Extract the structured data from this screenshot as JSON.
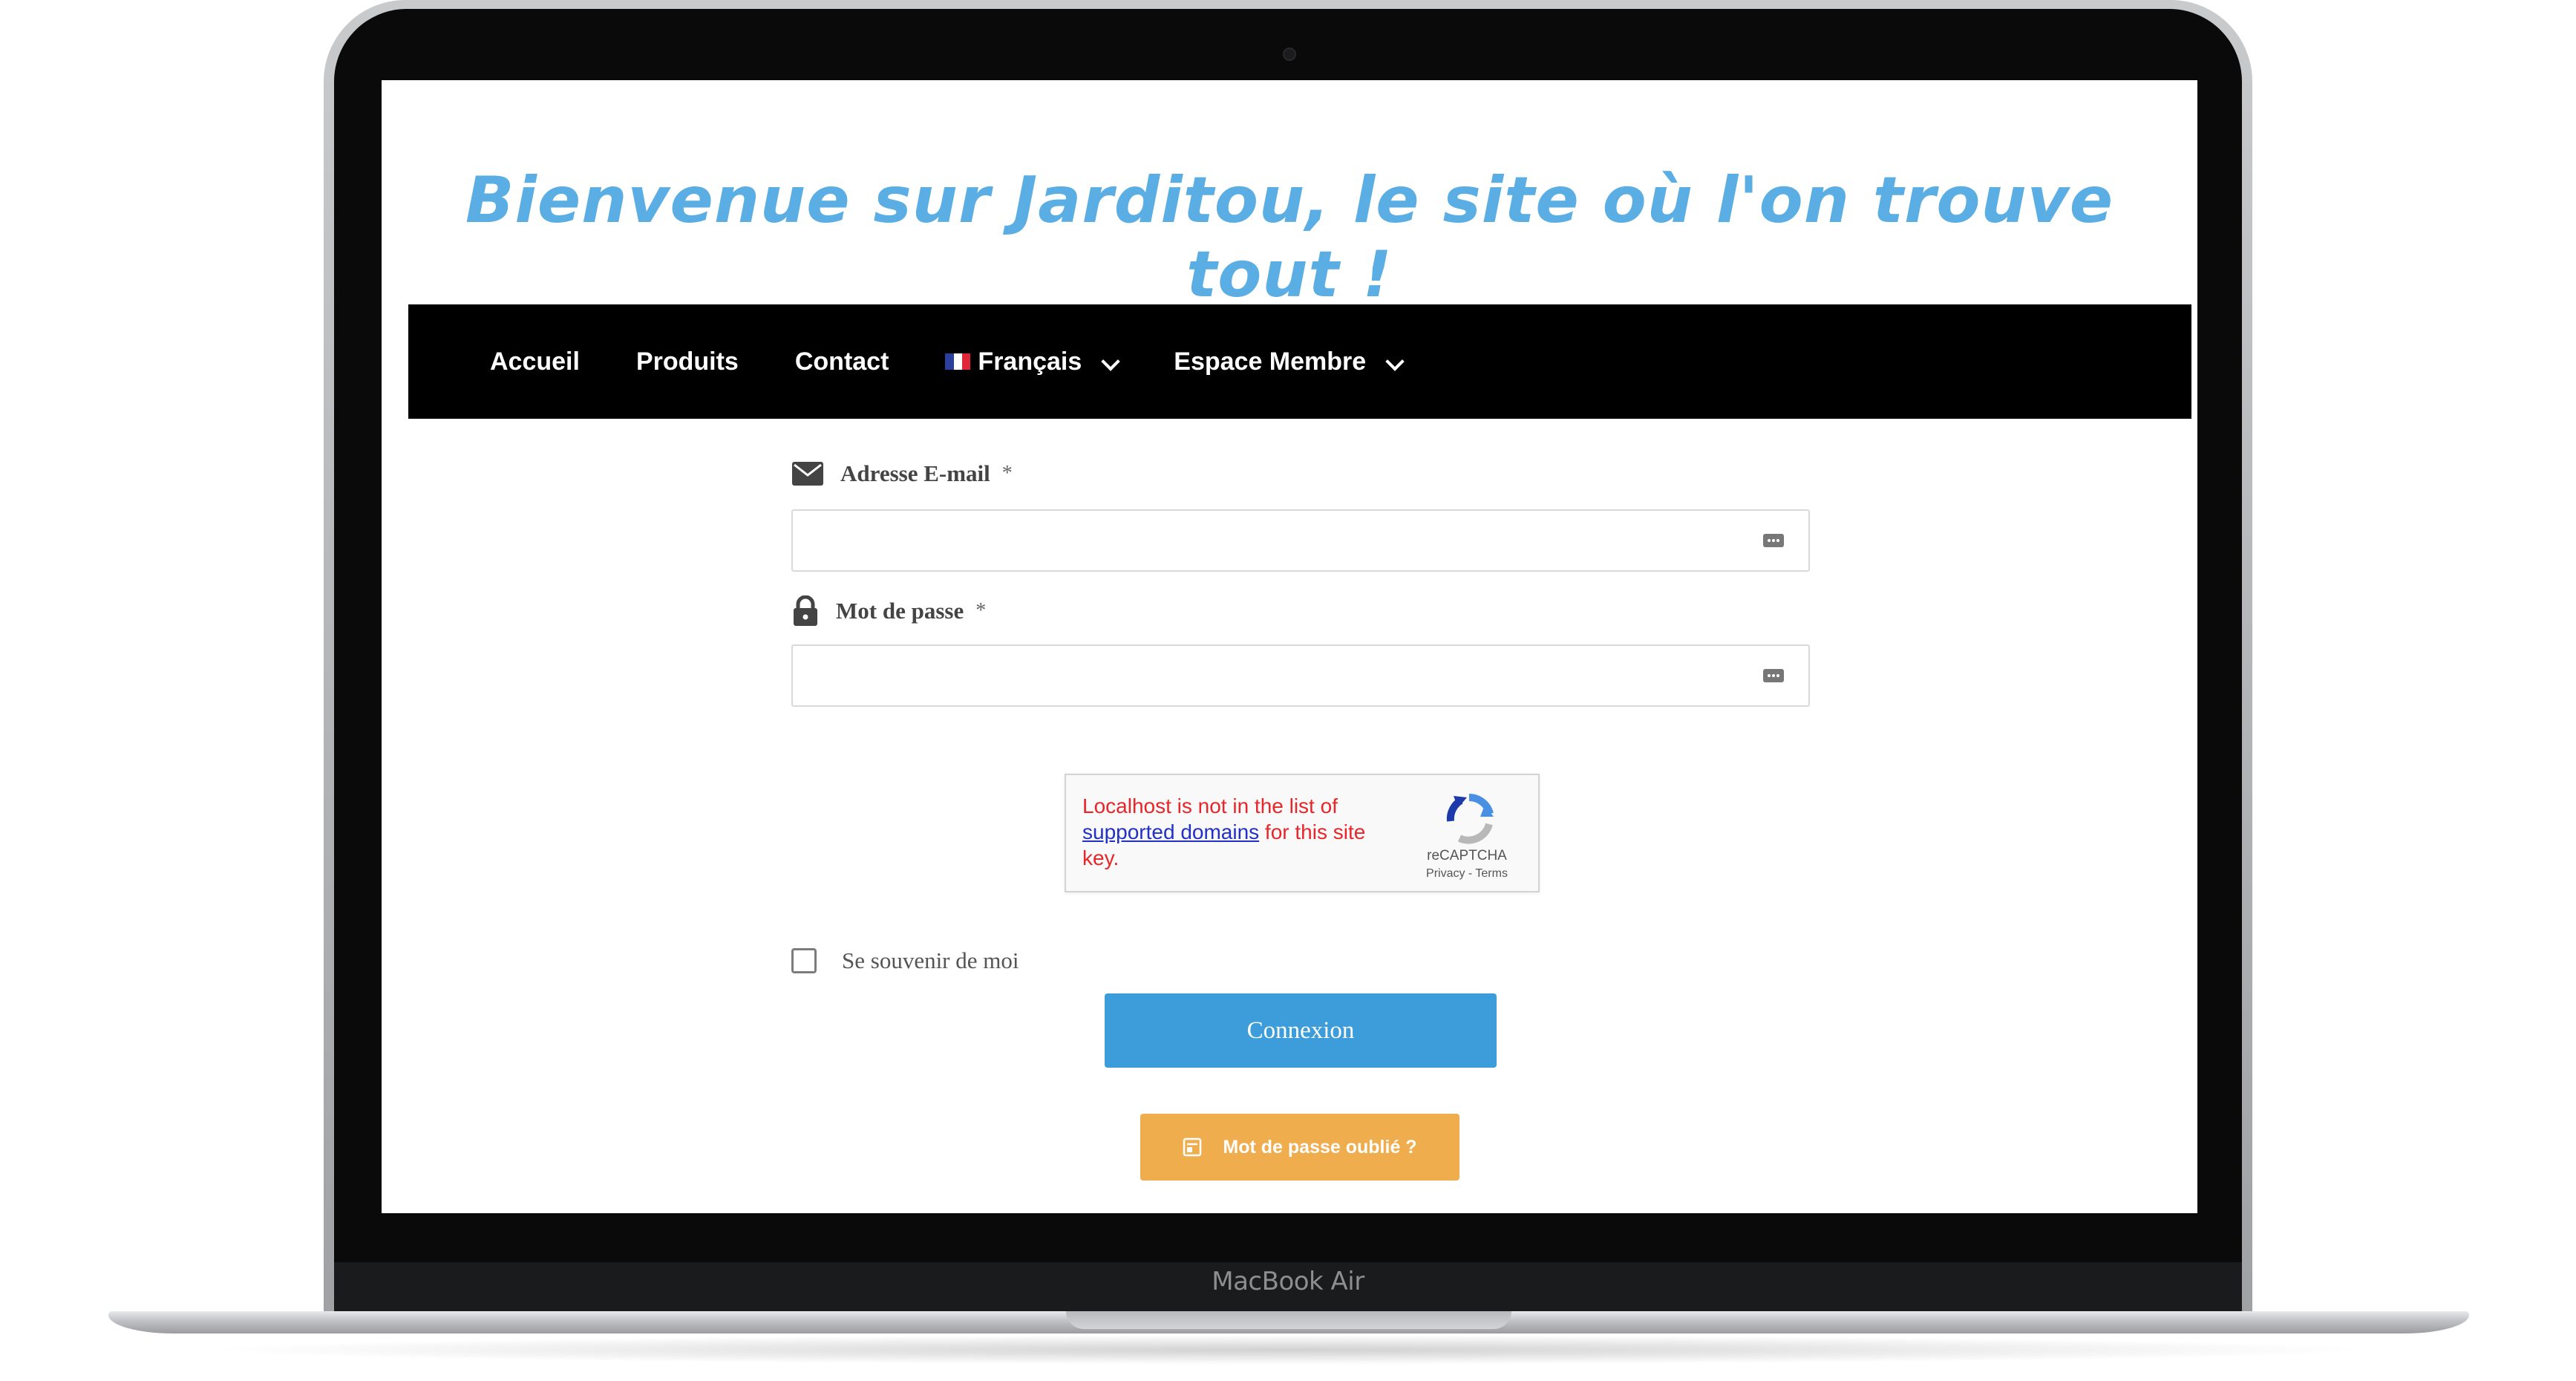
{
  "site": {
    "title": "Bienvenue sur Jarditou, le site où l'on trouve tout !"
  },
  "nav": {
    "items": [
      {
        "label": "Accueil"
      },
      {
        "label": "Produits"
      },
      {
        "label": "Contact"
      },
      {
        "label": "Français",
        "icon": "french-flag-icon",
        "dropdown": true
      },
      {
        "label": "Espace Membre",
        "dropdown": true
      }
    ]
  },
  "form": {
    "email_label": "Adresse E-mail",
    "email_required": "*",
    "email_icon": "envelope-icon",
    "email_value": "",
    "password_label": "Mot de passe",
    "password_required": "*",
    "password_icon": "lock-icon",
    "password_value": "",
    "field_icon": "password-manager-icon"
  },
  "recaptcha": {
    "error_prefix": "Localhost is not in the list of ",
    "error_link": "supported domains",
    "error_suffix": " for this site key.",
    "brand": "reCAPTCHA",
    "privacy": "Privacy",
    "separator": "-",
    "terms": "Terms"
  },
  "remember": {
    "label": "Se souvenir de moi",
    "checked": false
  },
  "buttons": {
    "login": "Connexion",
    "forgot": "Mot de passe oublié ?",
    "forgot_icon": "form-icon"
  },
  "device": {
    "label": "MacBook Air"
  },
  "colors": {
    "title": "#5aaee3",
    "navbar": "#000000",
    "login_button": "#3d9ddb",
    "forgot_button": "#f0ad4e",
    "captcha_error": "#e8262a"
  }
}
